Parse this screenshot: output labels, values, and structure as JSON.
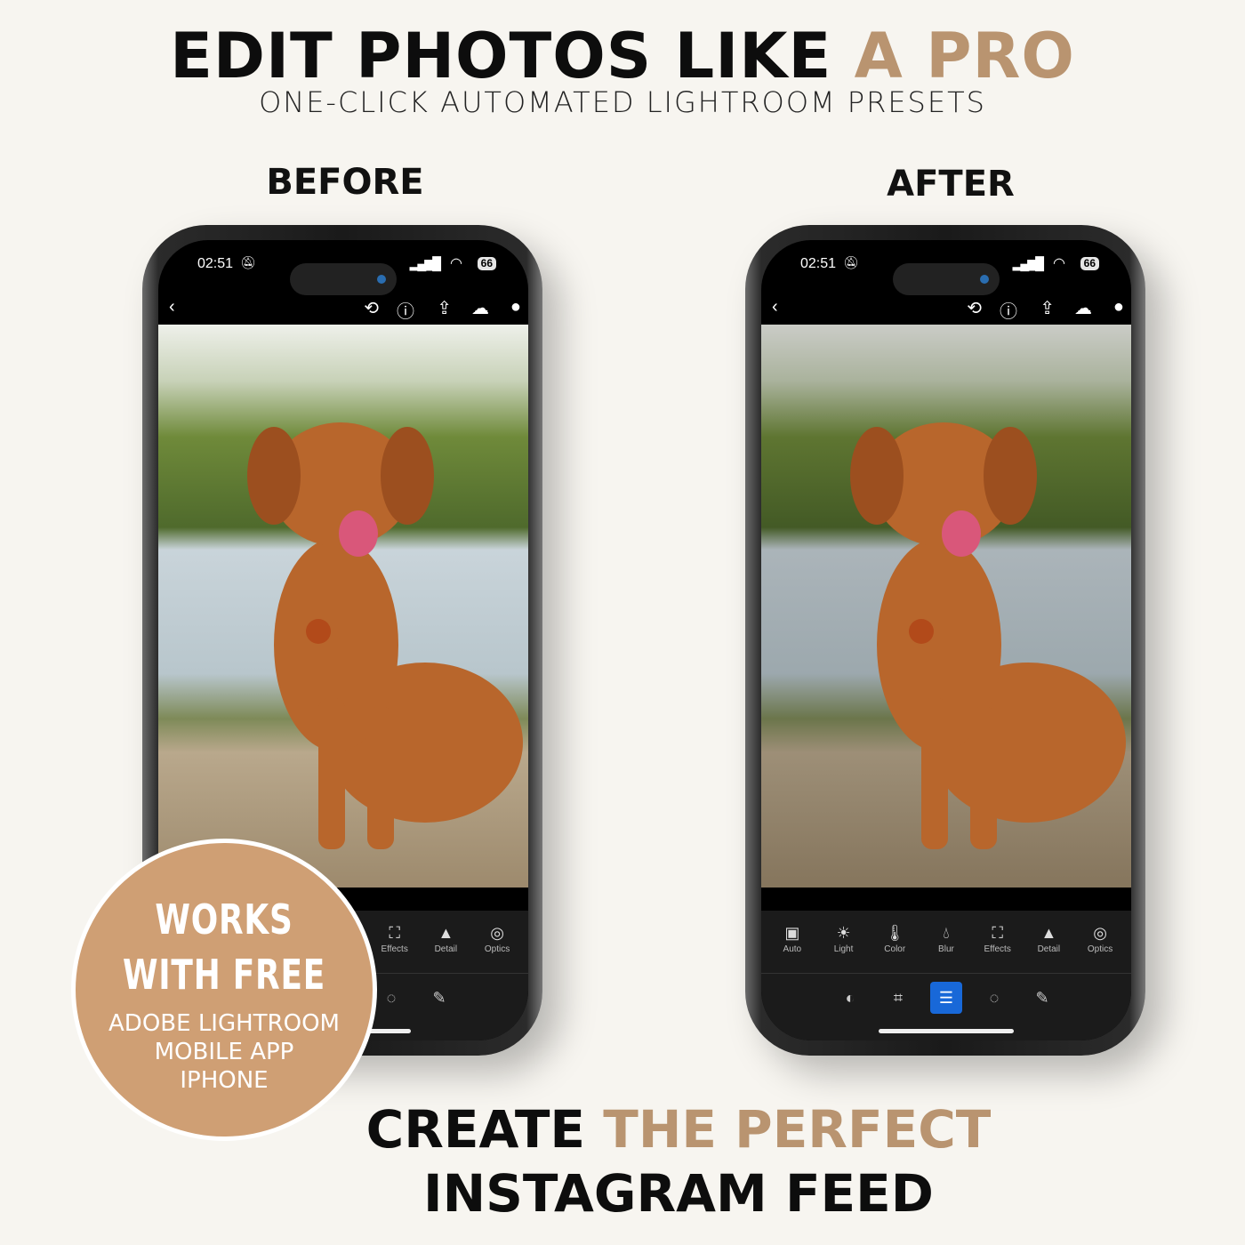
{
  "header": {
    "title_main": "EDIT PHOTOS LIKE",
    "title_accent": "A PRO",
    "subtitle": "ONE-CLICK AUTOMATED LIGHTROOM PRESETS"
  },
  "labels": {
    "before": "BEFORE",
    "after": "AFTER"
  },
  "phone": {
    "time": "02:51",
    "battery": "66",
    "top_icons": [
      "back-icon",
      "history-icon",
      "help-icon",
      "share-icon",
      "cloud-sync-icon",
      "more-icon"
    ],
    "tools": [
      {
        "label": "Auto",
        "icon": "auto-icon"
      },
      {
        "label": "Light",
        "icon": "sun-icon"
      },
      {
        "label": "Color",
        "icon": "thermometer-icon"
      },
      {
        "label": "Blur",
        "icon": "drop-icon"
      },
      {
        "label": "Effects",
        "icon": "vignette-icon"
      },
      {
        "label": "Detail",
        "icon": "triangle-icon"
      },
      {
        "label": "Optics",
        "icon": "lens-icon"
      }
    ],
    "bottom_tools": [
      "presets-icon",
      "crop-icon",
      "edit-sliders-icon",
      "masking-icon",
      "healing-icon"
    ],
    "active_bottom_tool": "edit-sliders-icon",
    "accent": "#1868d8"
  },
  "badge": {
    "line1": "WORKS",
    "line2": "WITH FREE",
    "line3": "ADOBE LIGHTROOM",
    "line4": "MOBILE APP",
    "line5": "IPHONE",
    "color": "#cf9f74"
  },
  "footer": {
    "line1_main": "CREATE",
    "line1_accent": "THE PERFECT",
    "line2": "INSTAGRAM FEED"
  },
  "colors": {
    "accent": "#b99470",
    "background": "#f7f5f0"
  }
}
